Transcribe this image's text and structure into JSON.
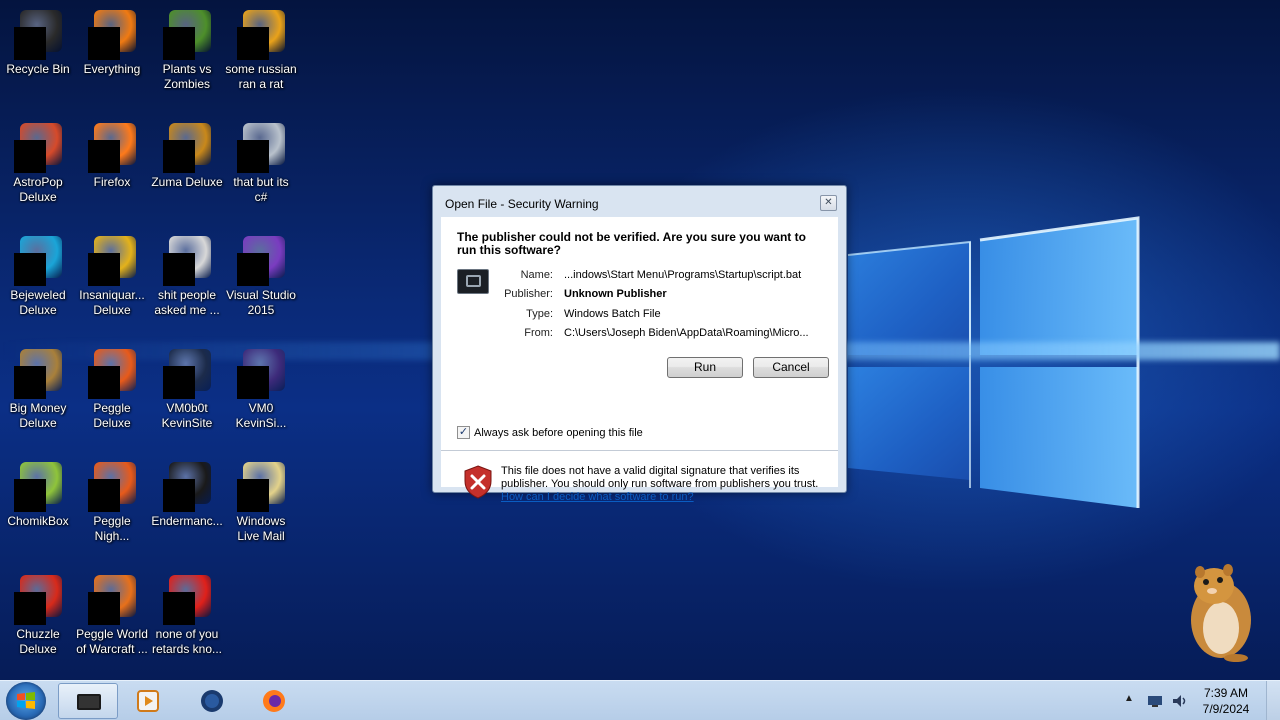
{
  "desktop_icons": [
    {
      "label": "Recycle Bin",
      "color": "#2a2a2a",
      "icon": "recycle-bin-icon"
    },
    {
      "label": "Everything",
      "color": "#f07a12",
      "icon": "everything-icon"
    },
    {
      "label": "Plants vs\nZombies",
      "color": "#4d8f2a",
      "icon": "plants-vs-zombies-icon"
    },
    {
      "label": "some russian\nran a rat",
      "color": "#e9a21a",
      "icon": "app-icon"
    },
    {
      "label": "AstroPop\nDeluxe",
      "color": "#d64a2a",
      "icon": "astropop-icon"
    },
    {
      "label": "Firefox",
      "color": "#ff7a1a",
      "icon": "firefox-icon"
    },
    {
      "label": "Zuma Deluxe",
      "color": "#c9881a",
      "icon": "zuma-icon"
    },
    {
      "label": "that but its\nc#",
      "color": "#b9c2cc",
      "icon": "file-stack-icon"
    },
    {
      "label": "Bejeweled\nDeluxe",
      "color": "#1aa5d8",
      "icon": "bejeweled-icon"
    },
    {
      "label": "Insaniquar...\nDeluxe",
      "color": "#e4b21a",
      "icon": "insaniquarium-icon"
    },
    {
      "label": "shit people\nasked me ...",
      "color": "#d8d8d8",
      "icon": "folder-icon"
    },
    {
      "label": "Visual Studio\n2015",
      "color": "#7a3cc0",
      "icon": "visual-studio-icon"
    },
    {
      "label": "Big Money\nDeluxe",
      "color": "#a9803a",
      "icon": "big-money-icon"
    },
    {
      "label": "Peggle\nDeluxe",
      "color": "#e85a1a",
      "icon": "peggle-icon"
    },
    {
      "label": "VM0b0t\nKevinSite",
      "color": "#1c2b4a",
      "icon": "vm-icon"
    },
    {
      "label": "VM0\nKevinSi...",
      "color": "#3d2a7a",
      "icon": "vm-icon"
    },
    {
      "label": "ChomikBox",
      "color": "#8fc43a",
      "icon": "chomikbox-icon"
    },
    {
      "label": "Peggle\nNigh...",
      "color": "#e85a1a",
      "icon": "peggle-nights-icon"
    },
    {
      "label": "Endermanc...",
      "color": "#1a1a1a",
      "icon": "console-icon"
    },
    {
      "label": "Windows\nLive Mail",
      "color": "#e3d28a",
      "icon": "mail-icon"
    },
    {
      "label": "Chuzzle\nDeluxe",
      "color": "#d82a1a",
      "icon": "chuzzle-icon"
    },
    {
      "label": "Peggle World\nof Warcraft ...",
      "color": "#e8701a",
      "icon": "peggle-wow-icon"
    },
    {
      "label": "none of you\nretards kno...",
      "color": "#e0201a",
      "icon": "app-icon"
    }
  ],
  "dialog": {
    "title": "Open File - Security Warning",
    "close_glyph": "✕",
    "question": "The publisher could not be verified.  Are you sure you want to run this software?",
    "properties": [
      {
        "key": "Name:",
        "value": "...indows\\Start Menu\\Programs\\Startup\\script.bat",
        "bold": false
      },
      {
        "key": "Publisher:",
        "value": "Unknown Publisher",
        "bold": true
      },
      {
        "key": "Type:",
        "value": "Windows Batch File",
        "bold": false
      },
      {
        "key": "From:",
        "value": "C:\\Users\\Joseph Biden\\AppData\\Roaming\\Micro...",
        "bold": false
      }
    ],
    "run_label": "Run",
    "cancel_label": "Cancel",
    "checkbox_label": "Always ask before opening this file",
    "checkbox_checked": true,
    "warning_text": "This file does not have a valid digital signature that verifies its publisher.  You should only run software from publishers you trust.",
    "warning_link": "How can I decide what software to run?"
  },
  "taskbar": {
    "clock_time": "7:39 AM",
    "clock_date": "7/9/2024",
    "tray_chevron": "▲"
  }
}
